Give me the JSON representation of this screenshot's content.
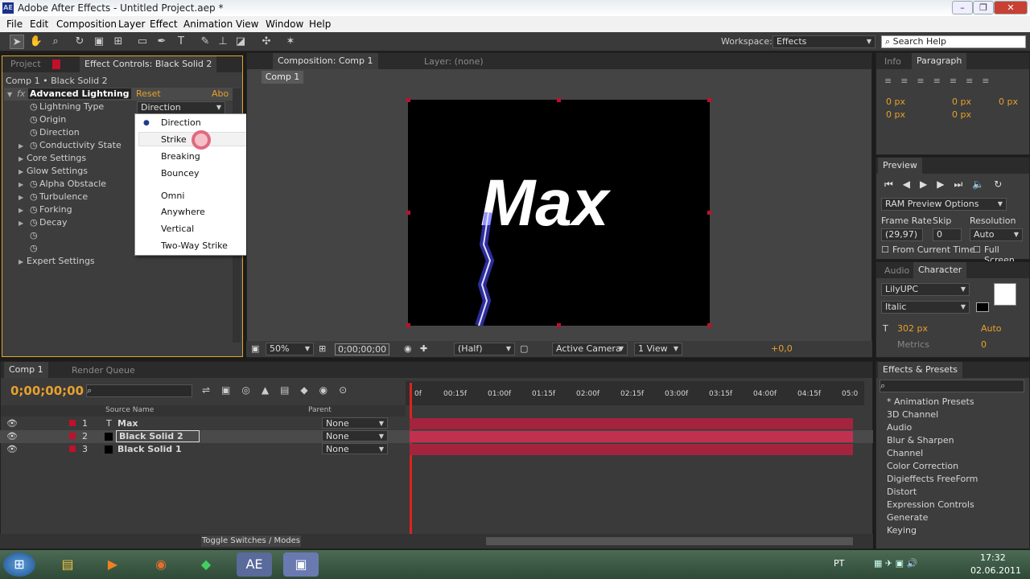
{
  "window": {
    "title": "Adobe After Effects - Untitled Project.aep *",
    "app_icon": "AE"
  },
  "menu": [
    "File",
    "Edit",
    "Composition",
    "Layer",
    "Effect",
    "Animation",
    "View",
    "Window",
    "Help"
  ],
  "toolbar": {
    "workspace_label": "Workspace:",
    "workspace_value": "Effects",
    "search_placeholder": "Search Help"
  },
  "project_panel": {
    "tab_project": "Project",
    "tab_effect_controls": "Effect Controls: Black Solid 2",
    "breadcrumb": "Comp 1 • Black Solid 2",
    "effect_name": "Advanced Lightning",
    "reset": "Reset",
    "about": "Abo",
    "lightning_type_label": "Lightning Type",
    "lightning_type_value": "Direction",
    "props": [
      "Origin",
      "Direction",
      "Conductivity State",
      "Core Settings",
      "Glow Settings",
      "Alpha Obstacle",
      "Turbulence",
      "Forking",
      "Decay",
      "Expert Settings"
    ]
  },
  "dropdown": {
    "items": [
      "Direction",
      "Strike",
      "Breaking",
      "Bouncey",
      "Omni",
      "Anywhere",
      "Vertical",
      "Two-Way Strike"
    ],
    "selected": "Direction"
  },
  "composition": {
    "tab": "Composition: Comp 1",
    "layer_tab": "Layer: (none)",
    "comp_button": "Comp 1",
    "text": "Max",
    "zoom": "50%",
    "timecode": "0;00;00;00",
    "resolution": "(Half)",
    "camera": "Active Camera",
    "view": "1 View",
    "exposure": "+0,0"
  },
  "info_panel": {
    "tab_info": "Info",
    "tab_paragraph": "Paragraph",
    "indent_values": [
      "0 px",
      "0 px",
      "0 px",
      "0 px",
      "0 px"
    ]
  },
  "preview": {
    "tab": "Preview",
    "ram_options": "RAM Preview Options",
    "frame_rate_label": "Frame Rate",
    "skip_label": "Skip",
    "resolution_label": "Resolution",
    "frame_rate": "(29,97)",
    "skip": "0",
    "resolution": "Auto",
    "from_current": "From Current Time",
    "full_screen": "Full Screen"
  },
  "character": {
    "tab_audio": "Audio",
    "tab_character": "Character",
    "font": "LilyUPC",
    "style": "Italic",
    "size": "302 px",
    "leading": "Auto",
    "tracking_label": "Metrics",
    "tracking": "0"
  },
  "timeline": {
    "tab_comp": "Comp 1",
    "tab_render": "Render Queue",
    "timecode": "0;00;00;00",
    "col_source": "Source Name",
    "col_parent": "Parent",
    "ruler": [
      "0f",
      "00:15f",
      "01:00f",
      "01:15f",
      "02:00f",
      "02:15f",
      "03:00f",
      "03:15f",
      "04:00f",
      "04:15f",
      "05:0"
    ],
    "layers": [
      {
        "num": "1",
        "name": "Max",
        "parent": "None"
      },
      {
        "num": "2",
        "name": "Black Solid 2",
        "parent": "None"
      },
      {
        "num": "3",
        "name": "Black Solid 1",
        "parent": "None"
      }
    ],
    "toggle": "Toggle Switches / Modes"
  },
  "effects_presets": {
    "tab": "Effects & Presets",
    "items": [
      "* Animation Presets",
      "3D Channel",
      "Audio",
      "Blur & Sharpen",
      "Channel",
      "Color Correction",
      "Digieffects FreeForm",
      "Distort",
      "Expression Controls",
      "Generate",
      "Keying"
    ]
  },
  "taskbar": {
    "lang": "PT",
    "time": "17:32",
    "date": "02.06.2011"
  },
  "colors": {
    "accent_orange": "#e8a02c",
    "layer_bar": "#a4243e"
  }
}
